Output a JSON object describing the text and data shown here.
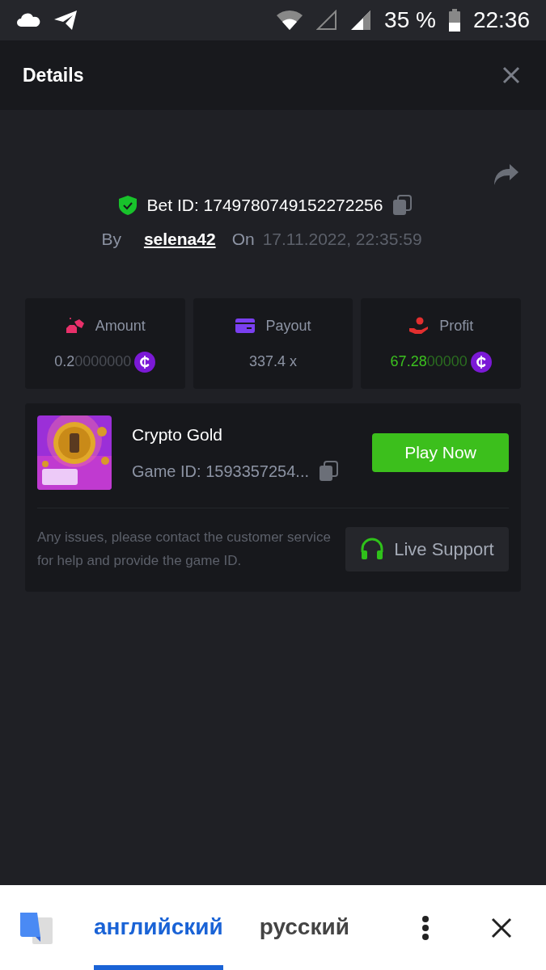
{
  "status_bar": {
    "battery": "35 %",
    "time": "22:36"
  },
  "header": {
    "title": "Details"
  },
  "bet": {
    "id_label": "Bet ID: 1749780749152272256",
    "by_label": "By",
    "user": "selena42",
    "on_label": "On",
    "date": "17.11.2022, 22:35:59"
  },
  "stats": [
    {
      "kind": "amount",
      "label": "Amount",
      "value_main": "0.2",
      "value_dim": "0000000",
      "coin": true
    },
    {
      "kind": "payout",
      "label": "Payout",
      "value_main": "337.4 x",
      "coin": false
    },
    {
      "kind": "profit",
      "label": "Profit",
      "value_main": "67.28",
      "value_dim": "00000",
      "coin": true
    }
  ],
  "game": {
    "name": "Crypto Gold",
    "id": "Game ID: 1593357254...",
    "play_button": "Play Now",
    "notice": "Any issues, please contact the customer service for help and provide the game ID.",
    "support_button": "Live Support"
  },
  "translate_bar": {
    "languages": [
      {
        "label": "английский",
        "selected": true
      },
      {
        "label": "русский",
        "selected": false
      }
    ]
  }
}
